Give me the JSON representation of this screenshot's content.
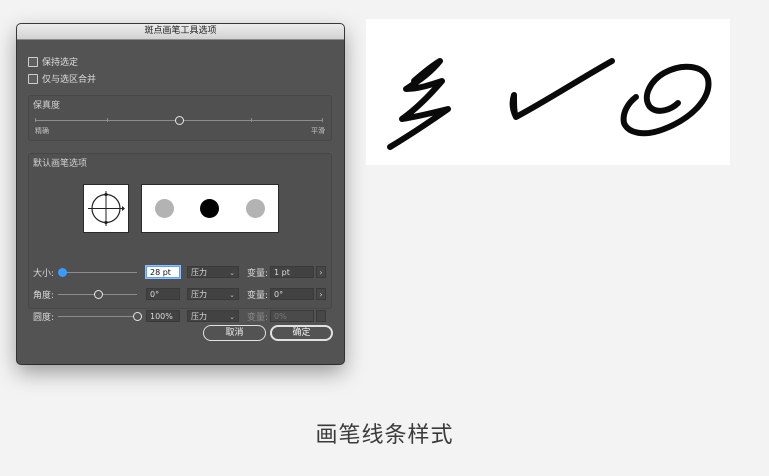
{
  "dialog": {
    "title": "斑点画笔工具选项",
    "keep_selected": "保持选定",
    "merge_selection": "仅与选区合并",
    "fidelity": {
      "label": "保真度",
      "min_label": "精确",
      "max_label": "平滑",
      "value": 0.5
    },
    "brush_options": {
      "label": "默认画笔选项",
      "rows": [
        {
          "label": "大小:",
          "value": "28 pt",
          "mode": "压力",
          "variation_label": "变量:",
          "variation_value": "1 pt",
          "slider": 0.05
        },
        {
          "label": "角度:",
          "value": "0°",
          "mode": "压力",
          "variation_label": "变量:",
          "variation_value": "0°",
          "slider": 0.5
        },
        {
          "label": "圆度:",
          "value": "100%",
          "mode": "压力",
          "variation_label": "变量:",
          "variation_value": "0%",
          "slider": 1.0
        }
      ]
    },
    "cancel_label": "取消",
    "ok_label": "确定"
  },
  "caption": "画笔线条样式",
  "colors": {
    "dialog_bg": "#535353",
    "accent": "#3a9bff",
    "preview_dot_gray": "#b3b3b3",
    "preview_dot_black": "#000000"
  }
}
